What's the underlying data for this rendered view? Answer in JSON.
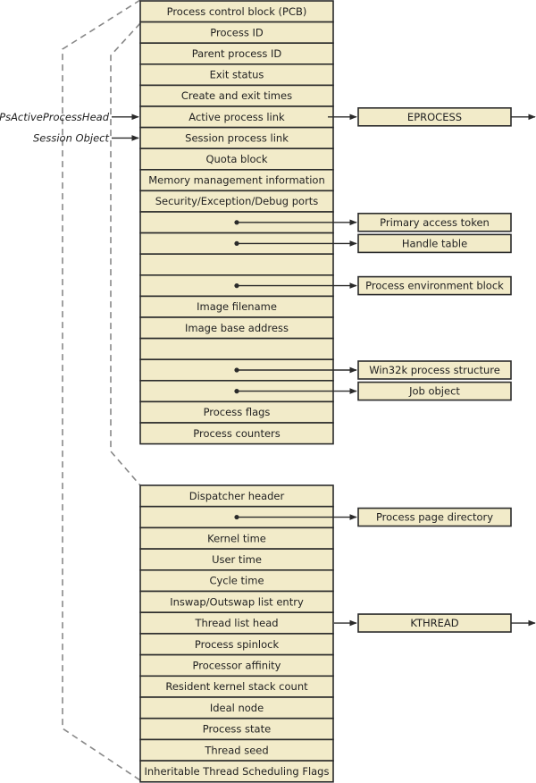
{
  "colors": {
    "fill": "#f2ebc9",
    "stroke": "#2b2b2b",
    "dash": "#888888"
  },
  "eprocess_fields": [
    {
      "label": "Process control block (PCB)"
    },
    {
      "label": "Process ID"
    },
    {
      "label": "Parent process ID"
    },
    {
      "label": "Exit status"
    },
    {
      "label": "Create and exit times"
    },
    {
      "label": "Active process link",
      "target": "EPROCESS",
      "incoming": "PsActiveProcessHead"
    },
    {
      "label": "Session process link",
      "incoming": "Session Object"
    },
    {
      "label": "Quota block"
    },
    {
      "label": "Memory management information"
    },
    {
      "label": "Security/Exception/Debug ports"
    },
    {
      "label": "",
      "target": "Primary access token"
    },
    {
      "label": "",
      "target": "Handle table"
    },
    {
      "label": ""
    },
    {
      "label": "",
      "target": "Process environment block"
    },
    {
      "label": "Image filename"
    },
    {
      "label": "Image base address"
    },
    {
      "label": ""
    },
    {
      "label": "",
      "target": "Win32k process structure"
    },
    {
      "label": "",
      "target": "Job object"
    },
    {
      "label": "Process flags"
    },
    {
      "label": "Process counters"
    }
  ],
  "kprocess_fields": [
    {
      "label": "Dispatcher header"
    },
    {
      "label": "",
      "target": "Process page directory"
    },
    {
      "label": "Kernel time"
    },
    {
      "label": "User time"
    },
    {
      "label": "Cycle time"
    },
    {
      "label": "Inswap/Outswap list entry"
    },
    {
      "label": "Thread list head",
      "target": "KTHREAD"
    },
    {
      "label": "Process spinlock"
    },
    {
      "label": "Processor affinity"
    },
    {
      "label": "Resident kernel stack count"
    },
    {
      "label": "Ideal node"
    },
    {
      "label": "Process state"
    },
    {
      "label": "Thread seed"
    },
    {
      "label": "Inheritable Thread Scheduling Flags"
    }
  ],
  "continuing_targets": [
    "EPROCESS",
    "KTHREAD"
  ]
}
